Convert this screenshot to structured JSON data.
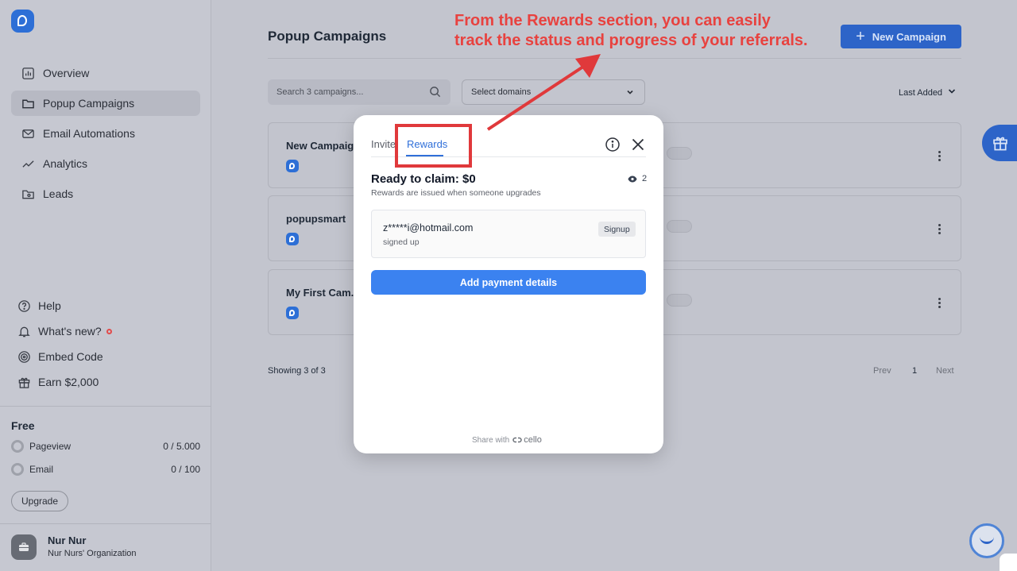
{
  "sidebar": {
    "nav": [
      {
        "label": "Overview",
        "icon": "overview-icon"
      },
      {
        "label": "Popup Campaigns",
        "icon": "folder-icon",
        "active": true
      },
      {
        "label": "Email Automations",
        "icon": "mail-icon"
      },
      {
        "label": "Analytics",
        "icon": "analytics-icon"
      },
      {
        "label": "Leads",
        "icon": "leads-icon"
      }
    ],
    "utility": [
      {
        "label": "Help",
        "icon": "help-icon"
      },
      {
        "label": "What's new?",
        "icon": "bell-icon"
      },
      {
        "label": "Embed Code",
        "icon": "embed-icon"
      },
      {
        "label": "Earn $2,000",
        "icon": "gift-icon"
      }
    ],
    "plan": {
      "name": "Free",
      "usage": [
        {
          "label": "Pageview",
          "value": "0 / 5.000"
        },
        {
          "label": "Email",
          "value": "0 / 100"
        }
      ],
      "upgrade_label": "Upgrade"
    },
    "user": {
      "name": "Nur Nur",
      "org": "Nur Nurs' Organization"
    }
  },
  "main": {
    "title": "Popup Campaigns",
    "new_button_label": "New Campaign",
    "search_placeholder": "Search 3 campaigns...",
    "domain_select_label": "Select domains",
    "sort_label": "Last Added",
    "campaigns": [
      {
        "name": "New Campaign"
      },
      {
        "name": "popupsmart"
      },
      {
        "name": "My First Cam..."
      }
    ],
    "showing": "Showing 3 of 3",
    "pagination": {
      "prev": "Prev",
      "page": "1",
      "next": "Next"
    }
  },
  "modal": {
    "tabs": [
      "Invite",
      "Rewards"
    ],
    "active_tab": "Rewards",
    "claim_title": "Ready to claim: $0",
    "claim_subtitle": "Rewards are issued when someone upgrades",
    "views_count": "2",
    "referral": {
      "email": "z*****i@hotmail.com",
      "status": "signed up",
      "badge": "Signup"
    },
    "pay_button_label": "Add payment details",
    "footer_text": "Share with",
    "footer_brand": "cello"
  },
  "annotation": {
    "line1": "From the Rewards section, you can easily",
    "line2": "track the status and progress of your referrals.",
    "color": "#e8423f"
  },
  "colors": {
    "accent": "#2d64c8",
    "modal_button": "#3b82f0",
    "tab_active": "#2f6fd9"
  }
}
